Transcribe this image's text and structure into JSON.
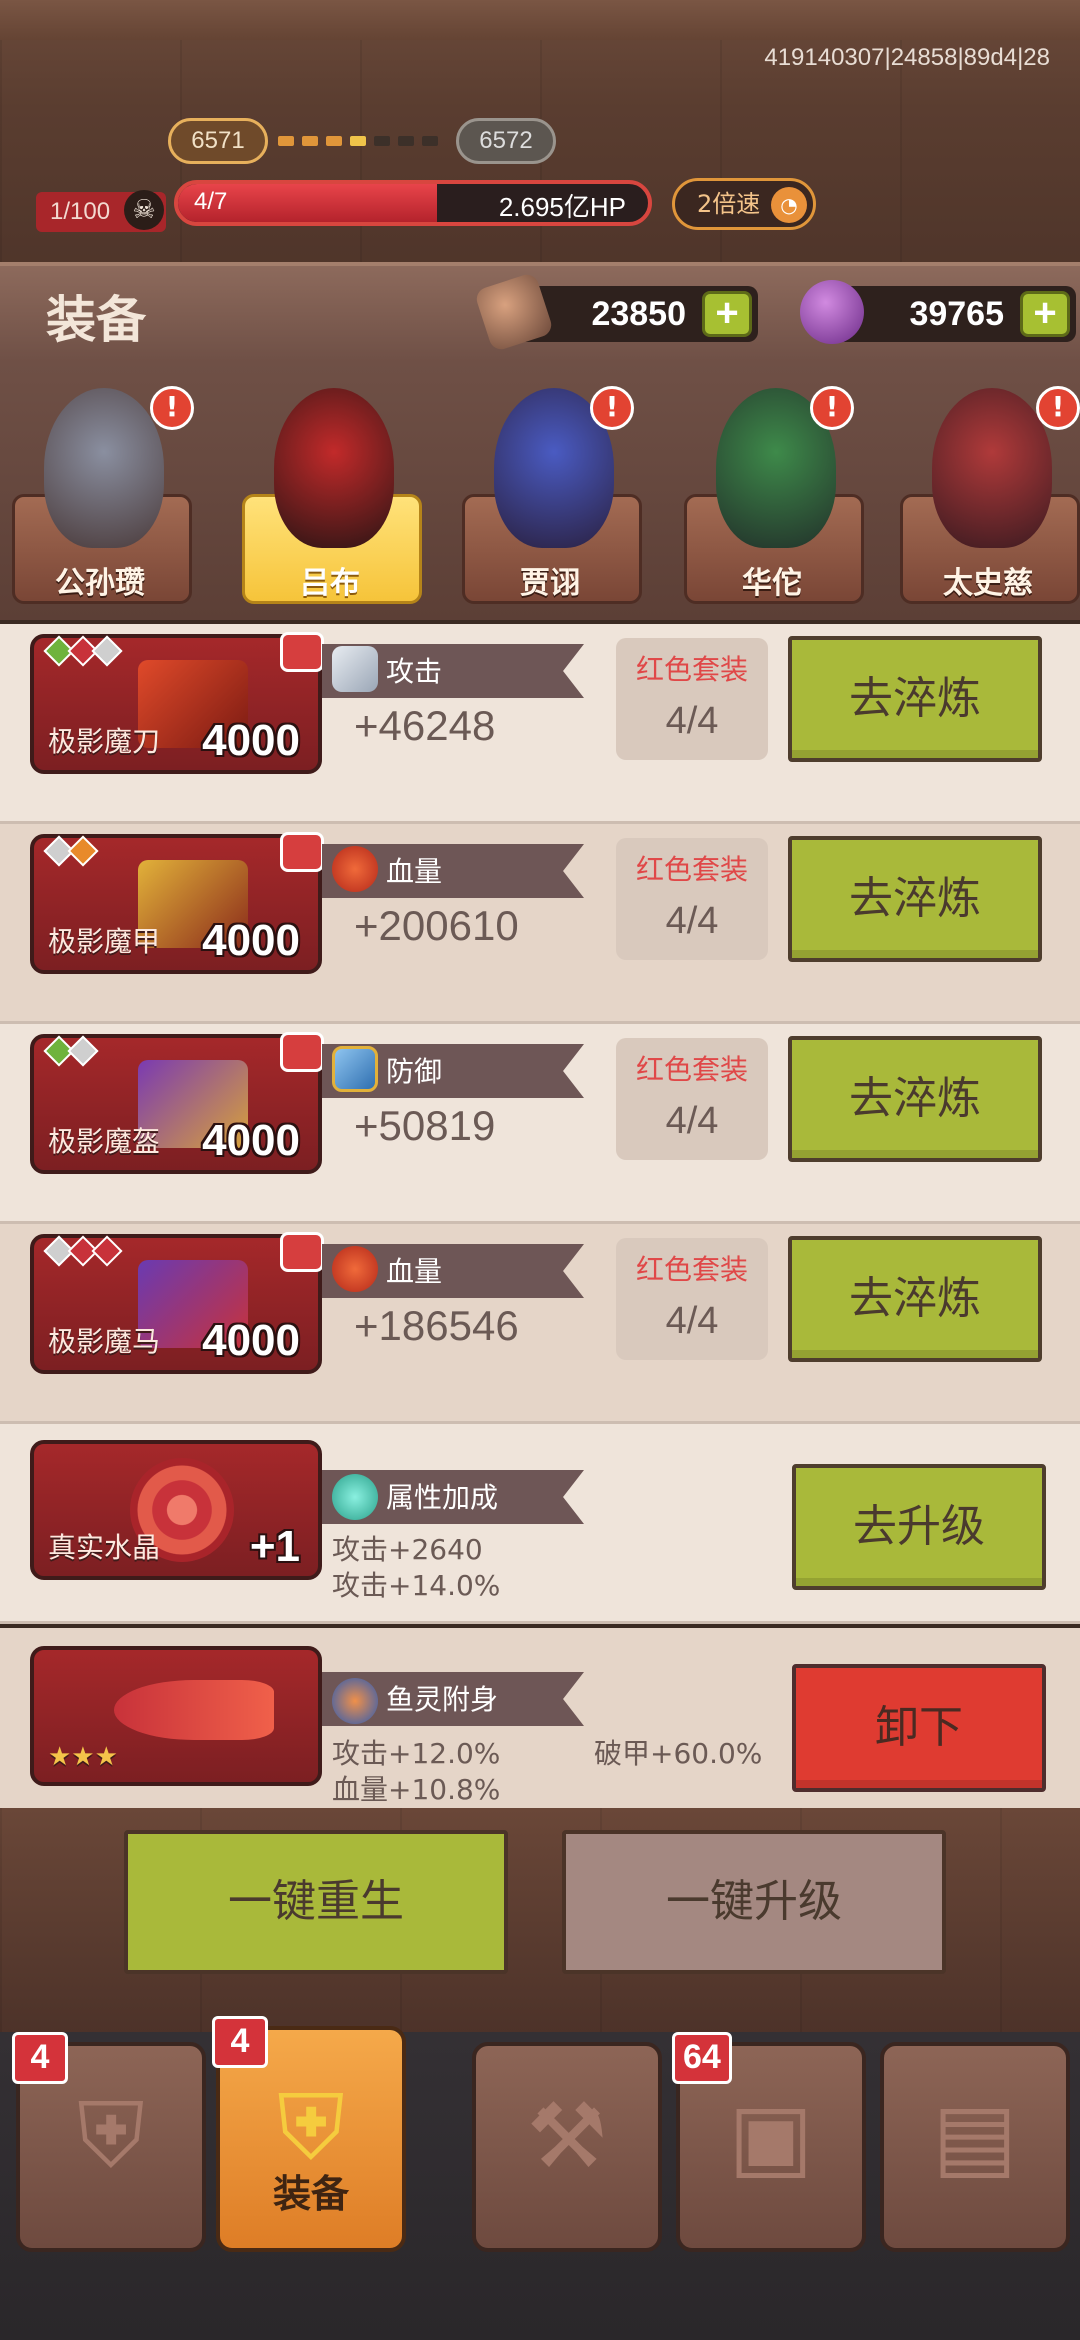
{
  "debug_info": "419140307|24858|89d4|28",
  "stage": {
    "current": "6571",
    "next": "6572"
  },
  "battle": {
    "kills": "1/100",
    "wave": "4/7",
    "boss_hp": "2.695亿HP",
    "hp_fraction": 0.55,
    "speed_label": "2倍速"
  },
  "header": {
    "title": "装备",
    "resource_stone": "23850",
    "resource_crystal": "39765"
  },
  "heroes": [
    {
      "name": "公孙瓒",
      "selected": false,
      "alert": true
    },
    {
      "name": "吕布",
      "selected": true,
      "alert": false
    },
    {
      "name": "贾诩",
      "selected": false,
      "alert": true
    },
    {
      "name": "华佗",
      "selected": false,
      "alert": true
    },
    {
      "name": "太史慈",
      "selected": false,
      "alert": true
    }
  ],
  "equipment": [
    {
      "name": "极影魔刀",
      "level": "4000",
      "stat_label": "攻击",
      "stat_icon": "sword-icon",
      "stat_value": "+46248",
      "set_title": "红色套装",
      "set_progress": "4/4",
      "action": "去淬炼"
    },
    {
      "name": "极影魔甲",
      "level": "4000",
      "stat_label": "血量",
      "stat_icon": "blood-drop-icon",
      "stat_value": "+200610",
      "set_title": "红色套装",
      "set_progress": "4/4",
      "action": "去淬炼"
    },
    {
      "name": "极影魔盔",
      "level": "4000",
      "stat_label": "防御",
      "stat_icon": "shield-icon",
      "stat_value": "+50819",
      "set_title": "红色套装",
      "set_progress": "4/4",
      "action": "去淬炼"
    },
    {
      "name": "极影魔马",
      "level": "4000",
      "stat_label": "血量",
      "stat_icon": "blood-drop-icon",
      "stat_value": "+186546",
      "set_title": "红色套装",
      "set_progress": "4/4",
      "action": "去淬炼"
    }
  ],
  "crystal": {
    "name": "真实水晶",
    "level": "+1",
    "stat_label": "属性加成",
    "lines": [
      "攻击+2640",
      "攻击+14.0%"
    ],
    "action": "去升级"
  },
  "fish_spirit": {
    "stat_label": "鱼灵附身",
    "lines": [
      "攻击+12.0%",
      "血量+10.8%"
    ],
    "extra": "破甲+60.0%",
    "stars": "★★★",
    "action": "卸下"
  },
  "actions": {
    "regen": "一键重生",
    "upgrade_all": "一键升级"
  },
  "nav": [
    {
      "id": "heroes",
      "label": "",
      "badge": "4"
    },
    {
      "id": "equip",
      "label": "装备",
      "badge": "4"
    },
    {
      "id": "forge",
      "label": "",
      "badge": ""
    },
    {
      "id": "chest",
      "label": "",
      "badge": "64"
    },
    {
      "id": "map",
      "label": "",
      "badge": ""
    }
  ]
}
